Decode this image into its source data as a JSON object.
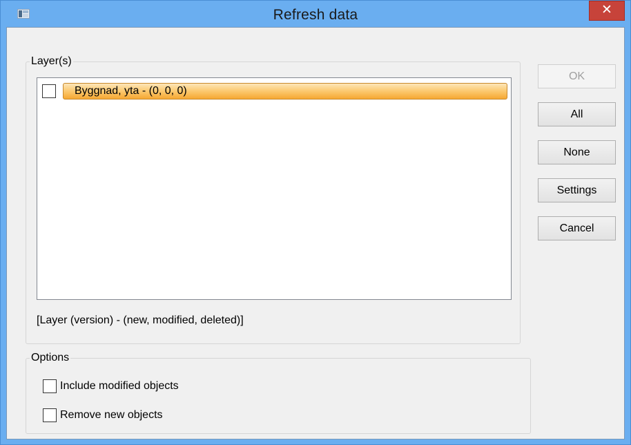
{
  "window": {
    "title": "Refresh data",
    "close_glyph": "✕",
    "accent_color": "#6aaef0",
    "close_color": "#c7433a"
  },
  "layers_group": {
    "legend": "Layer(s)",
    "items": [
      {
        "label": "Byggnad, yta - (0, 0, 0)",
        "checked": false,
        "highlight_color": "#fccb75"
      }
    ],
    "legend_text": "[Layer (version) - (new, modified, deleted)]"
  },
  "options_group": {
    "legend": "Options",
    "include_modified": {
      "label": "Include modified objects",
      "checked": false
    },
    "remove_new": {
      "label": "Remove new objects",
      "checked": false
    }
  },
  "buttons": {
    "ok": {
      "label": "OK",
      "enabled": false
    },
    "all": {
      "label": "All",
      "enabled": true
    },
    "none": {
      "label": "None",
      "enabled": true
    },
    "settings": {
      "label": "Settings",
      "enabled": true
    },
    "cancel": {
      "label": "Cancel",
      "enabled": true
    }
  }
}
